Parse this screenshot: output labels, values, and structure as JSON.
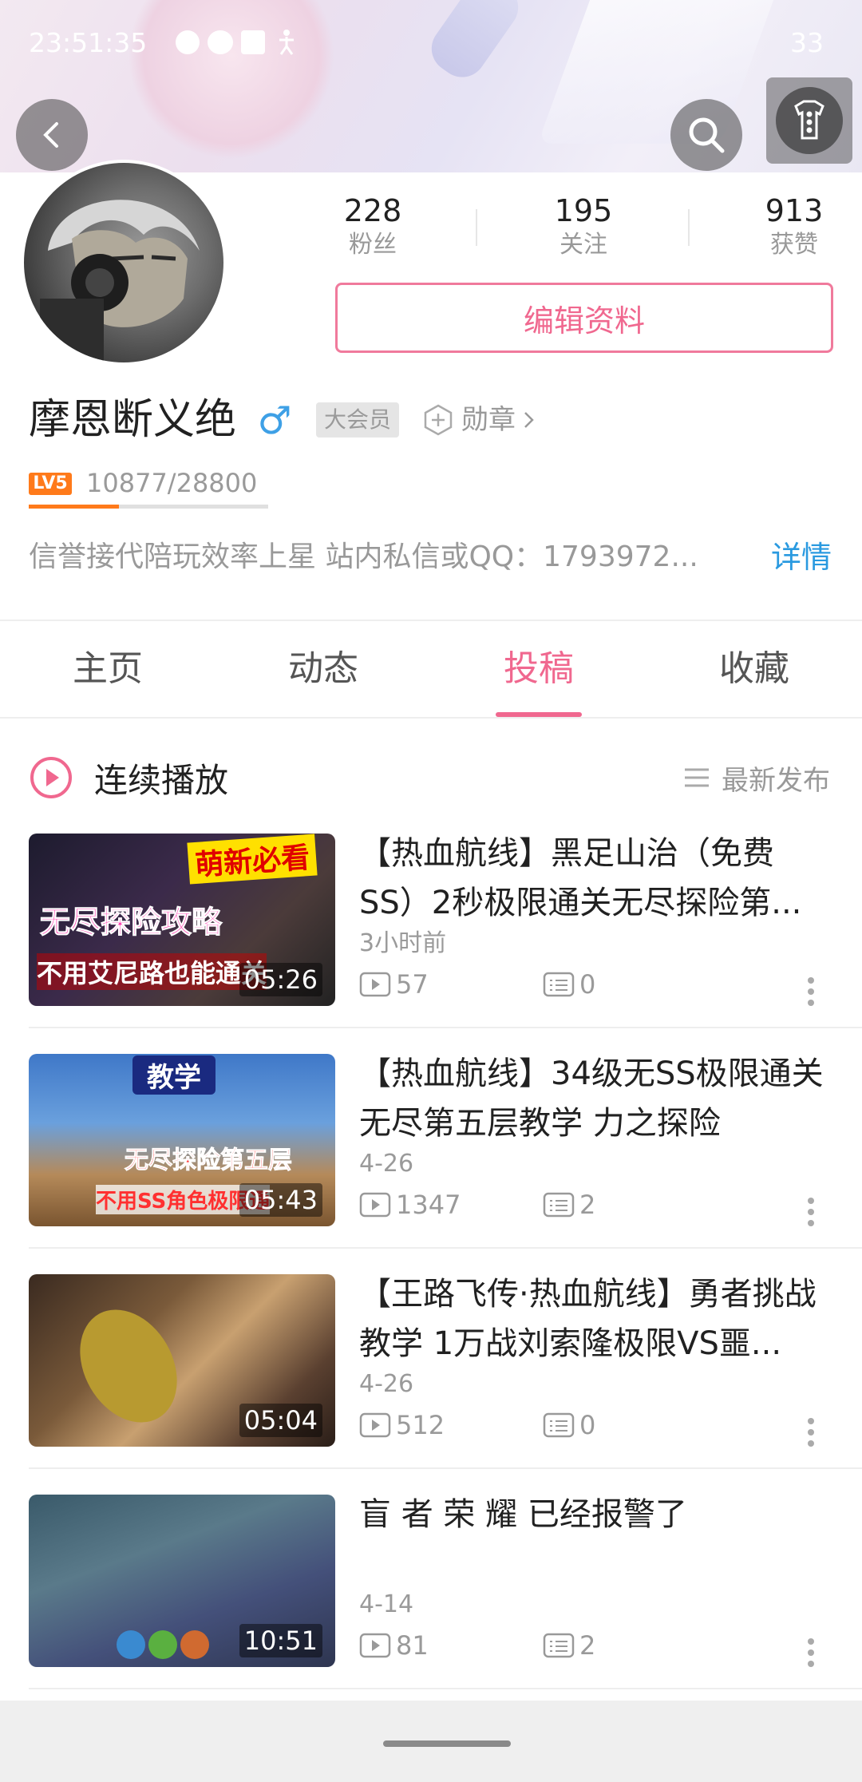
{
  "status_bar": {
    "time": "23:51:35",
    "battery": "33"
  },
  "profile": {
    "username": "摩恩断义绝",
    "gender_symbol": "♂",
    "vip_badge": "大会员",
    "medal_label": "勋章",
    "level_badge": "LV5",
    "exp_text": "10877/28800",
    "exp_progress": 0.378,
    "signature": "信誉接代陪玩效率上星  站内私信或QQ：1793972...",
    "detail_link": "详情",
    "edit_button": "编辑资料"
  },
  "stats": [
    {
      "value": "228",
      "label": "粉丝"
    },
    {
      "value": "195",
      "label": "关注"
    },
    {
      "value": "913",
      "label": "获赞"
    }
  ],
  "tabs": [
    {
      "label": "主页",
      "active": false
    },
    {
      "label": "动态",
      "active": false
    },
    {
      "label": "投稿",
      "active": true
    },
    {
      "label": "收藏",
      "active": false
    }
  ],
  "continuous_play": "连续播放",
  "sort_label": "最新发布",
  "videos": [
    {
      "title": "【热血航线】黑足山治（免费SS）2秒极限通关无尽探险第...",
      "date": "3小时前",
      "plays": "57",
      "comments": "0",
      "duration": "05:26",
      "thumb_texts": [
        "萌新必看",
        "无尽探险攻略",
        "不用艾尼路也能通关"
      ]
    },
    {
      "title": "【热血航线】34级无SS极限通关无尽第五层教学 力之探险",
      "date": "4-26",
      "plays": "1347",
      "comments": "2",
      "duration": "05:43",
      "thumb_texts": [
        "教学",
        "无尽探险第五层",
        "不用SS角色极限通"
      ]
    },
    {
      "title": "【王路飞传·热血航线】勇者挑战教学 1万战刘索隆极限VS噩...",
      "date": "4-26",
      "plays": "512",
      "comments": "0",
      "duration": "05:04",
      "thumb_texts": []
    },
    {
      "title": "盲 者 荣 耀 已经报警了",
      "date": "4-14",
      "plays": "81",
      "comments": "2",
      "duration": "10:51",
      "thumb_texts": []
    }
  ],
  "colors": {
    "accent": "#f0688f",
    "link": "#2a9ae0",
    "level": "#ff7a1a"
  }
}
